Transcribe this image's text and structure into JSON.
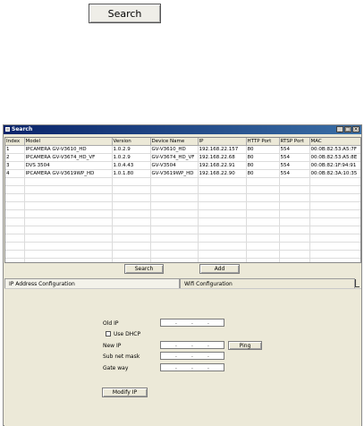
{
  "top_button": {
    "label": "Search"
  },
  "window": {
    "title": "Search",
    "controls": {
      "minimize": "_",
      "maximize": "□",
      "close": "×"
    }
  },
  "table": {
    "columns": [
      "Index",
      "Model",
      "Version",
      "Device Name",
      "IP",
      "HTTP Port",
      "RTSP Port",
      "MAC"
    ],
    "rows": [
      [
        "1",
        "IPCAMERA GV-V3610_HD",
        "1.0.2.9",
        "GV-V3610_HD",
        "192.168.22.157",
        "80",
        "554",
        "00:0B:82:53:A5:7F"
      ],
      [
        "2",
        "IPCAMERA GV-V3674_HD_VF",
        "1.0.2.9",
        "GV-V3674_HD_VF",
        "192.168.22.68",
        "80",
        "554",
        "00:0B:82:53:A5:8E"
      ],
      [
        "3",
        "DVS 3504",
        "1.0.4.43",
        "GV-V3504",
        "192.168.22.91",
        "80",
        "554",
        "00:0B:82:1F:94:91"
      ],
      [
        "4",
        "IPCAMERA GV-V3619WP_HD",
        "1.0.1.80",
        "GV-V3619WP_HD",
        "192.168.22.90",
        "80",
        "554",
        "00:0B:82:3A:10:35"
      ]
    ]
  },
  "actions": {
    "search": "Search",
    "add": "Add"
  },
  "tabs": [
    "IP Address Configuration",
    "Wifi Configuration"
  ],
  "ip_config": {
    "old_ip_label": "Old IP",
    "dhcp_label": "Use DHCP",
    "new_ip_label": "New IP",
    "subnet_label": "Sub net mask",
    "gateway_label": "Gate way",
    "ping_label": "Ping",
    "modify_label": "Modify IP",
    "ip_dot": "."
  }
}
